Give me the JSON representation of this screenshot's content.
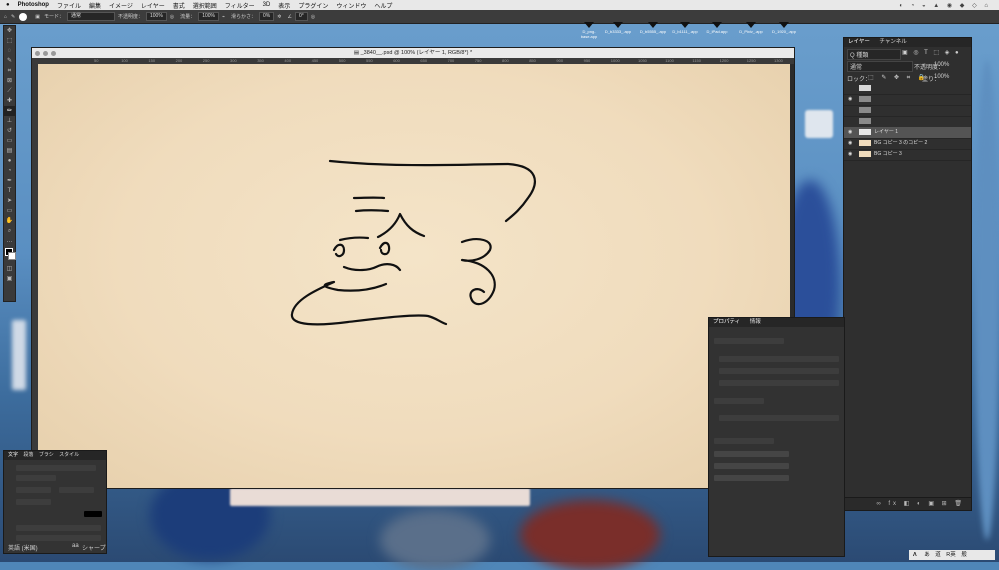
{
  "menubar": {
    "apple": "",
    "app_name": "Photoshop",
    "items": [
      "ファイル",
      "編集",
      "イメージ",
      "レイヤー",
      "書式",
      "選択範囲",
      "フィルター",
      "3D",
      "表示",
      "プラグイン",
      "ウィンドウ",
      "ヘルプ"
    ]
  },
  "options_bar": {
    "mode_label": "モード：",
    "mode_value": "通常",
    "opacity_label": "不透明度：",
    "opacity_value": "100%",
    "flow_label": "流量：",
    "flow_value": "100%",
    "smoothing_label": "滑らかさ：",
    "smoothing_value": "0%",
    "angle_value": "0°"
  },
  "dock_apps": [
    {
      "label": "D_png-base.app"
    },
    {
      "label": "D_b3333_.app"
    },
    {
      "label": "D_b5555_.app"
    },
    {
      "label": "D_b1111_.app"
    },
    {
      "label": "D_iPad.app"
    },
    {
      "label": "D_Pixiv_.app"
    },
    {
      "label": "D_1920_.app"
    }
  ],
  "document": {
    "title": "_3840__.psd @ 100% (レイヤー 1, RGB/8*) *",
    "ruler_ticks": [
      "50",
      "100",
      "150",
      "200",
      "250",
      "300",
      "350",
      "400",
      "450",
      "500",
      "550",
      "600",
      "650",
      "700",
      "750",
      "800",
      "850",
      "900",
      "950",
      "1000",
      "1050",
      "1100",
      "1150",
      "1200",
      "1250",
      "1300"
    ]
  },
  "layers_panel": {
    "tab_layers": "レイヤー",
    "tab_channels": "チャンネル",
    "search_kind": "Q 種類",
    "blend_mode": "通常",
    "opacity_label": "不透明度：",
    "opacity_value": "100%",
    "lock_label": "ロック：",
    "fill_label": "塗り：",
    "fill_value": "100%",
    "rows": [
      {
        "name": "",
        "thumb": "#d9d9d9",
        "visible": false,
        "selected": false
      },
      {
        "name": "",
        "thumb": "#8a8a8a",
        "visible": true,
        "selected": false
      },
      {
        "name": "",
        "thumb": "#8a8a8a",
        "visible": false,
        "selected": false
      },
      {
        "name": "",
        "thumb": "#8a8a8a",
        "visible": false,
        "selected": false
      },
      {
        "name": "レイヤー 1",
        "thumb": "#e8e8e8",
        "visible": true,
        "selected": true
      },
      {
        "name": "BG コピー 3 のコピー 2",
        "thumb": "#f0dcbd",
        "visible": true,
        "selected": false
      },
      {
        "name": "BG コピー 3",
        "thumb": "#f0dcbd",
        "visible": true,
        "selected": false
      }
    ]
  },
  "properties_panel": {
    "tab_properties": "プロパティ",
    "tab_info": "情報"
  },
  "text_panel": {
    "tabs": [
      "文字",
      "段落",
      "ブラシ",
      "スタイル"
    ],
    "language": "英語 (米国)",
    "aa_label": "aa",
    "aa_value": "シャープ"
  },
  "ime": {
    "chars": [
      "あ",
      "道",
      "R英",
      "般"
    ]
  },
  "colors": {
    "canvas": "#f0dcbd",
    "panel": "#2f2f2f",
    "stroke": "#111111",
    "selected_layer": "#545454"
  }
}
